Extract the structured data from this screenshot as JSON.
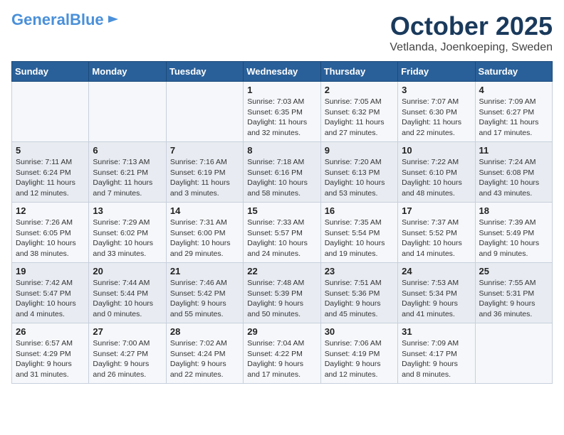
{
  "header": {
    "logo_line1": "General",
    "logo_line2": "Blue",
    "month": "October 2025",
    "location": "Vetlanda, Joenkoeping, Sweden"
  },
  "days_of_week": [
    "Sunday",
    "Monday",
    "Tuesday",
    "Wednesday",
    "Thursday",
    "Friday",
    "Saturday"
  ],
  "weeks": [
    [
      {
        "day": "",
        "content": ""
      },
      {
        "day": "",
        "content": ""
      },
      {
        "day": "",
        "content": ""
      },
      {
        "day": "1",
        "content": "Sunrise: 7:03 AM\nSunset: 6:35 PM\nDaylight: 11 hours\nand 32 minutes."
      },
      {
        "day": "2",
        "content": "Sunrise: 7:05 AM\nSunset: 6:32 PM\nDaylight: 11 hours\nand 27 minutes."
      },
      {
        "day": "3",
        "content": "Sunrise: 7:07 AM\nSunset: 6:30 PM\nDaylight: 11 hours\nand 22 minutes."
      },
      {
        "day": "4",
        "content": "Sunrise: 7:09 AM\nSunset: 6:27 PM\nDaylight: 11 hours\nand 17 minutes."
      }
    ],
    [
      {
        "day": "5",
        "content": "Sunrise: 7:11 AM\nSunset: 6:24 PM\nDaylight: 11 hours\nand 12 minutes."
      },
      {
        "day": "6",
        "content": "Sunrise: 7:13 AM\nSunset: 6:21 PM\nDaylight: 11 hours\nand 7 minutes."
      },
      {
        "day": "7",
        "content": "Sunrise: 7:16 AM\nSunset: 6:19 PM\nDaylight: 11 hours\nand 3 minutes."
      },
      {
        "day": "8",
        "content": "Sunrise: 7:18 AM\nSunset: 6:16 PM\nDaylight: 10 hours\nand 58 minutes."
      },
      {
        "day": "9",
        "content": "Sunrise: 7:20 AM\nSunset: 6:13 PM\nDaylight: 10 hours\nand 53 minutes."
      },
      {
        "day": "10",
        "content": "Sunrise: 7:22 AM\nSunset: 6:10 PM\nDaylight: 10 hours\nand 48 minutes."
      },
      {
        "day": "11",
        "content": "Sunrise: 7:24 AM\nSunset: 6:08 PM\nDaylight: 10 hours\nand 43 minutes."
      }
    ],
    [
      {
        "day": "12",
        "content": "Sunrise: 7:26 AM\nSunset: 6:05 PM\nDaylight: 10 hours\nand 38 minutes."
      },
      {
        "day": "13",
        "content": "Sunrise: 7:29 AM\nSunset: 6:02 PM\nDaylight: 10 hours\nand 33 minutes."
      },
      {
        "day": "14",
        "content": "Sunrise: 7:31 AM\nSunset: 6:00 PM\nDaylight: 10 hours\nand 29 minutes."
      },
      {
        "day": "15",
        "content": "Sunrise: 7:33 AM\nSunset: 5:57 PM\nDaylight: 10 hours\nand 24 minutes."
      },
      {
        "day": "16",
        "content": "Sunrise: 7:35 AM\nSunset: 5:54 PM\nDaylight: 10 hours\nand 19 minutes."
      },
      {
        "day": "17",
        "content": "Sunrise: 7:37 AM\nSunset: 5:52 PM\nDaylight: 10 hours\nand 14 minutes."
      },
      {
        "day": "18",
        "content": "Sunrise: 7:39 AM\nSunset: 5:49 PM\nDaylight: 10 hours\nand 9 minutes."
      }
    ],
    [
      {
        "day": "19",
        "content": "Sunrise: 7:42 AM\nSunset: 5:47 PM\nDaylight: 10 hours\nand 4 minutes."
      },
      {
        "day": "20",
        "content": "Sunrise: 7:44 AM\nSunset: 5:44 PM\nDaylight: 10 hours\nand 0 minutes."
      },
      {
        "day": "21",
        "content": "Sunrise: 7:46 AM\nSunset: 5:42 PM\nDaylight: 9 hours\nand 55 minutes."
      },
      {
        "day": "22",
        "content": "Sunrise: 7:48 AM\nSunset: 5:39 PM\nDaylight: 9 hours\nand 50 minutes."
      },
      {
        "day": "23",
        "content": "Sunrise: 7:51 AM\nSunset: 5:36 PM\nDaylight: 9 hours\nand 45 minutes."
      },
      {
        "day": "24",
        "content": "Sunrise: 7:53 AM\nSunset: 5:34 PM\nDaylight: 9 hours\nand 41 minutes."
      },
      {
        "day": "25",
        "content": "Sunrise: 7:55 AM\nSunset: 5:31 PM\nDaylight: 9 hours\nand 36 minutes."
      }
    ],
    [
      {
        "day": "26",
        "content": "Sunrise: 6:57 AM\nSunset: 4:29 PM\nDaylight: 9 hours\nand 31 minutes."
      },
      {
        "day": "27",
        "content": "Sunrise: 7:00 AM\nSunset: 4:27 PM\nDaylight: 9 hours\nand 26 minutes."
      },
      {
        "day": "28",
        "content": "Sunrise: 7:02 AM\nSunset: 4:24 PM\nDaylight: 9 hours\nand 22 minutes."
      },
      {
        "day": "29",
        "content": "Sunrise: 7:04 AM\nSunset: 4:22 PM\nDaylight: 9 hours\nand 17 minutes."
      },
      {
        "day": "30",
        "content": "Sunrise: 7:06 AM\nSunset: 4:19 PM\nDaylight: 9 hours\nand 12 minutes."
      },
      {
        "day": "31",
        "content": "Sunrise: 7:09 AM\nSunset: 4:17 PM\nDaylight: 9 hours\nand 8 minutes."
      },
      {
        "day": "",
        "content": ""
      }
    ]
  ]
}
